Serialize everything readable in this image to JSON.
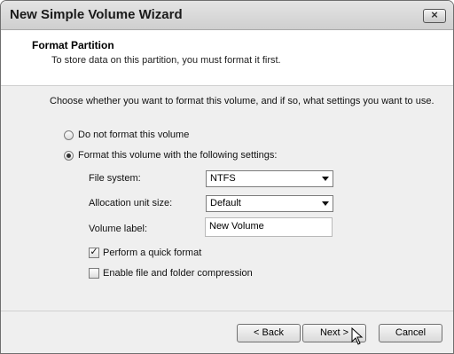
{
  "window": {
    "title": "New Simple Volume Wizard"
  },
  "header": {
    "title": "Format Partition",
    "subtitle": "To store data on this partition, you must format it first."
  },
  "main": {
    "intro": "Choose whether you want to format this volume, and if so, what settings you want to use.",
    "options": [
      {
        "label": "Do not format this volume",
        "selected": false
      },
      {
        "label": "Format this volume with the following settings:",
        "selected": true
      }
    ],
    "settings": {
      "file_system_label": "File system:",
      "file_system_value": "NTFS",
      "allocation_label": "Allocation unit size:",
      "allocation_value": "Default",
      "volume_label_label": "Volume label:",
      "volume_label_value": "New Volume"
    },
    "checkboxes": [
      {
        "label": "Perform a quick format",
        "checked": true
      },
      {
        "label": "Enable file and folder compression",
        "checked": false
      }
    ]
  },
  "footer": {
    "back_label": "< Back",
    "next_label": "Next >",
    "cancel_label": "Cancel"
  },
  "icons": {
    "close": "close-icon",
    "cursor": "mouse-pointer-icon",
    "check": "checkmark-icon",
    "dropdown": "chevron-down-icon"
  }
}
